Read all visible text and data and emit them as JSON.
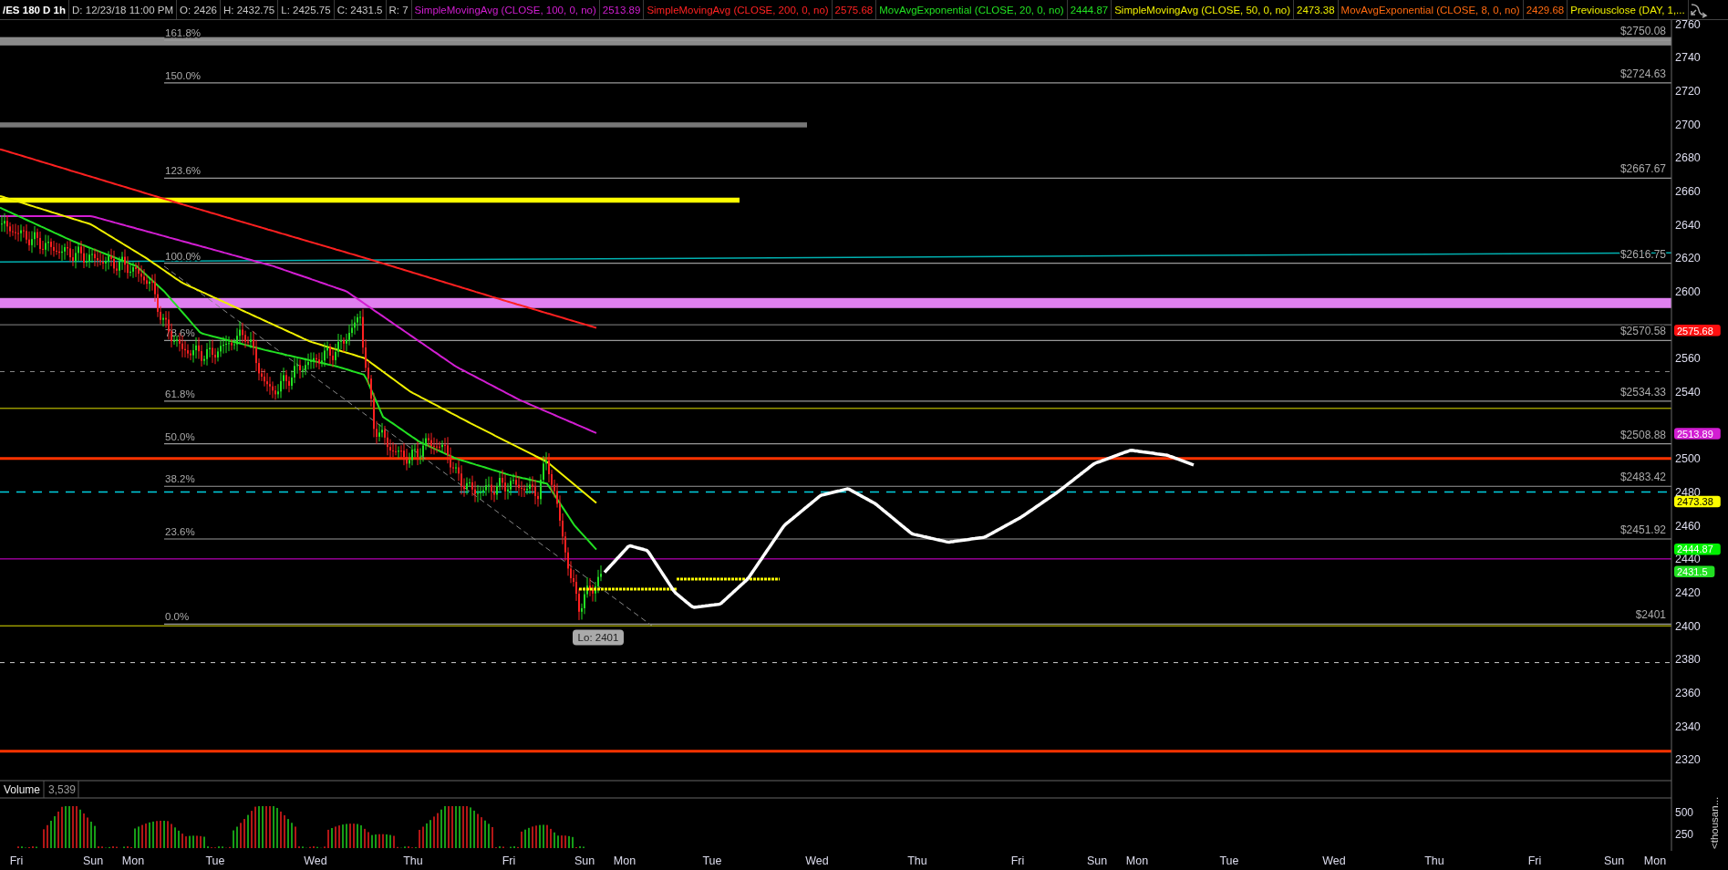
{
  "header": {
    "symbol": "/ES 180 D 1h",
    "info": [
      "D: 12/23/18 11:00 PM",
      "O: 2426",
      "H: 2432.75",
      "L: 2425.75",
      "C: 2431.5",
      "R: 7"
    ],
    "studies": [
      {
        "name": "SimpleMovingAvg (CLOSE, 100, 0, no)",
        "value": "2513.89",
        "color": "#d21ed2"
      },
      {
        "name": "SimpleMovingAvg (CLOSE, 200, 0, no)",
        "value": "2575.68",
        "color": "#ff2222"
      },
      {
        "name": "MovAvgExponential (CLOSE, 20, 0, no)",
        "value": "2444.87",
        "color": "#22e022"
      },
      {
        "name": "SimpleMovingAvg (CLOSE, 50, 0, no)",
        "value": "2473.38",
        "color": "#f0f000"
      },
      {
        "name": "MovAvgExponential (CLOSE, 8, 0, no)",
        "value": "2429.68",
        "color": "#ff6a10"
      },
      {
        "name": "Previousclose (DAY, 1,...",
        "color": "#f0f000"
      }
    ]
  },
  "price_pane": {
    "fib_levels": [
      {
        "percent": "161.8%",
        "price": "$2750.08"
      },
      {
        "percent": "150.0%",
        "price": "$2724.63"
      },
      {
        "percent": "123.6%",
        "price": "$2667.67"
      },
      {
        "percent": "100.0%",
        "price": "$2616.75"
      },
      {
        "percent": "78.6%",
        "price": "$2570.58"
      },
      {
        "percent": "61.8%",
        "price": "$2534.33"
      },
      {
        "percent": "50.0%",
        "price": "$2508.88"
      },
      {
        "percent": "38.2%",
        "price": "$2483.42"
      },
      {
        "percent": "23.6%",
        "price": "$2451.92"
      },
      {
        "percent": "0.0%",
        "price": "$2401"
      }
    ],
    "low_bubble": "Lo: 2401",
    "axis_ticks": [
      "2760",
      "2740",
      "2720",
      "2700",
      "2680",
      "2660",
      "2640",
      "2620",
      "2600",
      "2560",
      "2540",
      "2500",
      "2480",
      "2460",
      "2440",
      "2420",
      "2400",
      "2380",
      "2360",
      "2340",
      "2320"
    ],
    "badges": [
      {
        "text": "2575.68",
        "color": "#ff1010"
      },
      {
        "text": "2513.89",
        "color": "#d21ed2"
      },
      {
        "text": "2473.38",
        "color": "#ffff00"
      },
      {
        "text": "2444.87",
        "color": "#00f000"
      },
      {
        "text": "2431.5",
        "color": "#22e022"
      }
    ]
  },
  "volume_pane": {
    "label": "Volume",
    "value": "3,539",
    "axis_ticks": [
      "500",
      "250"
    ],
    "unit": "<thousan..."
  },
  "time_axis": [
    "Fri",
    "Sun",
    "Mon",
    "Tue",
    "Wed",
    "Thu",
    "Fri",
    "Sun",
    "Mon",
    "Tue",
    "Wed",
    "Thu",
    "Fri",
    "Sun",
    "Mon",
    "Tue",
    "Wed",
    "Thu",
    "Fri",
    "Sun",
    "Mon"
  ]
}
